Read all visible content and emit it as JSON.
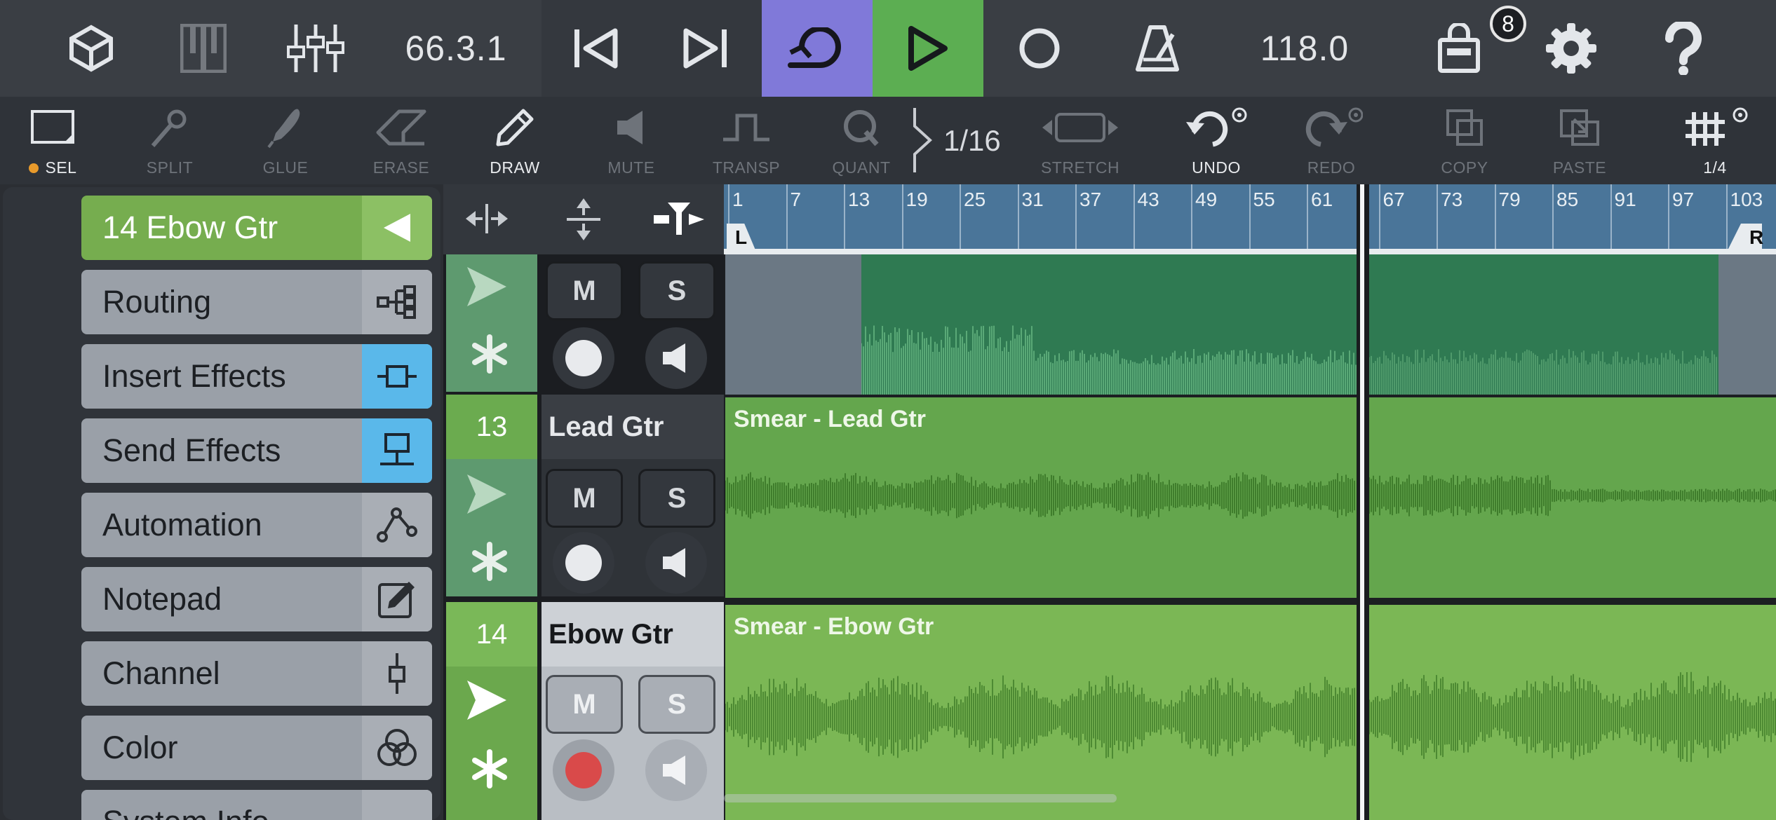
{
  "transport": {
    "position": "66.3.1",
    "tempo": "118.0",
    "shop_badge": "8",
    "colors": {
      "loop_active": "#8079d9",
      "play_active": "#5cae52"
    }
  },
  "tools": {
    "items": [
      {
        "label": "SEL",
        "icon": "selection-rect-icon"
      },
      {
        "label": "SPLIT",
        "icon": "scissors-icon"
      },
      {
        "label": "GLUE",
        "icon": "glue-icon"
      },
      {
        "label": "ERASE",
        "icon": "eraser-icon"
      },
      {
        "label": "DRAW",
        "icon": "pencil-icon"
      },
      {
        "label": "MUTE",
        "icon": "speaker-icon"
      },
      {
        "label": "TRANSP",
        "icon": "transpose-icon"
      },
      {
        "label": "QUANT",
        "icon": "quantize-icon"
      },
      {
        "label": "STRETCH",
        "icon": "stretch-icon"
      },
      {
        "label": "UNDO",
        "icon": "undo-icon"
      },
      {
        "label": "REDO",
        "icon": "redo-icon"
      },
      {
        "label": "COPY",
        "icon": "copy-icon"
      },
      {
        "label": "PASTE",
        "icon": "paste-icon"
      }
    ],
    "quant_value": "1/16",
    "grid_value": "1/4"
  },
  "menu": {
    "title": "14  Ebow Gtr",
    "items": [
      {
        "label": "Routing",
        "icon": "routing-icon"
      },
      {
        "label": "Insert Effects",
        "icon": "insert-effects-icon"
      },
      {
        "label": "Send Effects",
        "icon": "send-effects-icon"
      },
      {
        "label": "Automation",
        "icon": "automation-icon"
      },
      {
        "label": "Notepad",
        "icon": "notepad-icon"
      },
      {
        "label": "Channel",
        "icon": "channel-icon"
      },
      {
        "label": "Color",
        "icon": "color-icon"
      },
      {
        "label": "System Info",
        "icon": "menu-icon"
      }
    ]
  },
  "tracks": [
    {
      "number": "",
      "name": "",
      "clip_title": ""
    },
    {
      "number": "13",
      "name": "Lead Gtr",
      "clip_title": "Smear - Lead Gtr"
    },
    {
      "number": "14",
      "name": "Ebow Gtr",
      "clip_title": "Smear - Ebow Gtr"
    }
  ],
  "track_buttons": {
    "mute": "M",
    "solo": "S"
  },
  "ruler": {
    "bars": [
      "1",
      "7",
      "13",
      "19",
      "25",
      "31",
      "37",
      "43",
      "49",
      "55",
      "61",
      "67",
      "73",
      "79",
      "85",
      "91",
      "97",
      "103"
    ],
    "left_locator": "L",
    "right_locator": "R"
  }
}
